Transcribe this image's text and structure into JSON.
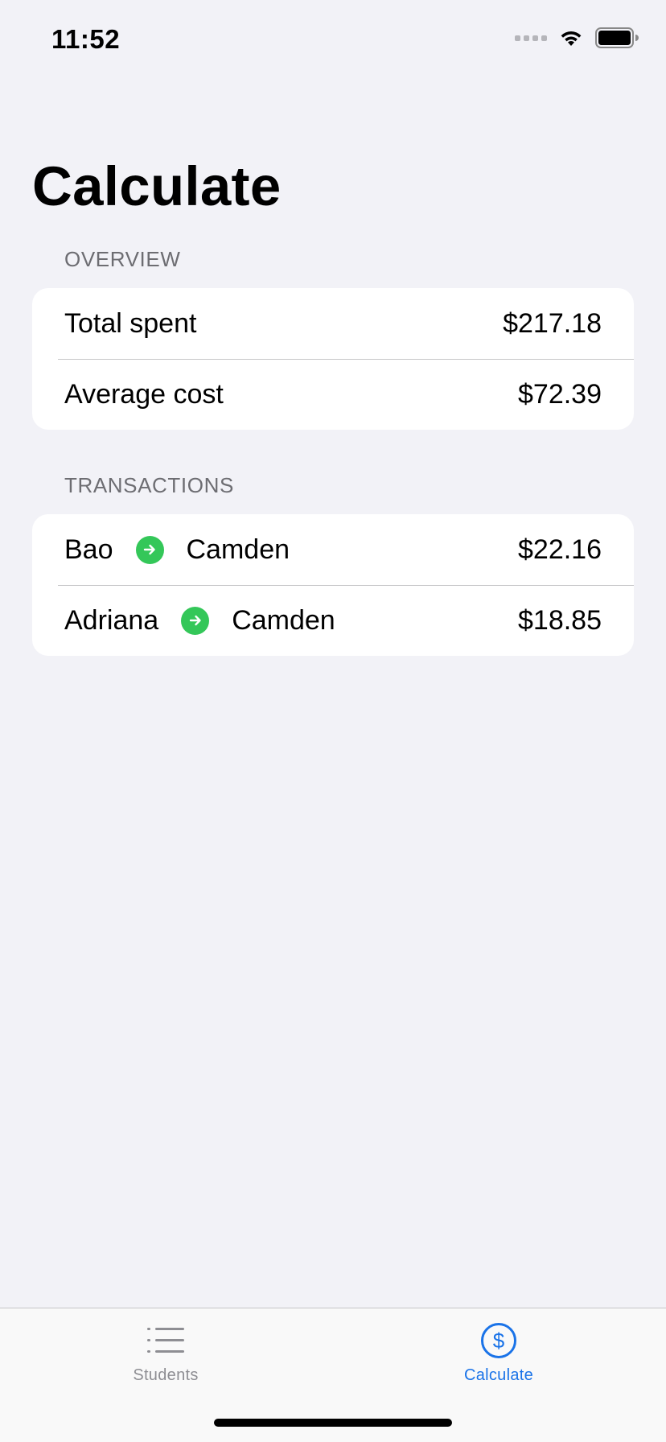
{
  "status_bar": {
    "time": "11:52"
  },
  "page": {
    "title": "Calculate"
  },
  "overview": {
    "header": "OVERVIEW",
    "rows": [
      {
        "label": "Total spent",
        "value": "$217.18"
      },
      {
        "label": "Average cost",
        "value": "$72.39"
      }
    ]
  },
  "transactions": {
    "header": "TRANSACTIONS",
    "rows": [
      {
        "from": "Bao",
        "to": "Camden",
        "amount": "$22.16",
        "icon": "arrow-right-circle-icon"
      },
      {
        "from": "Adriana",
        "to": "Camden",
        "amount": "$18.85",
        "icon": "arrow-right-circle-icon"
      }
    ]
  },
  "tab_bar": {
    "tabs": [
      {
        "label": "Students",
        "icon": "list-icon",
        "selected": false
      },
      {
        "label": "Calculate",
        "icon": "dollar-circle-icon",
        "selected": true
      }
    ]
  },
  "colors": {
    "accent": "#1a73e8",
    "success": "#34c759",
    "inactive": "#8e8e93",
    "background": "#f2f2f7"
  }
}
